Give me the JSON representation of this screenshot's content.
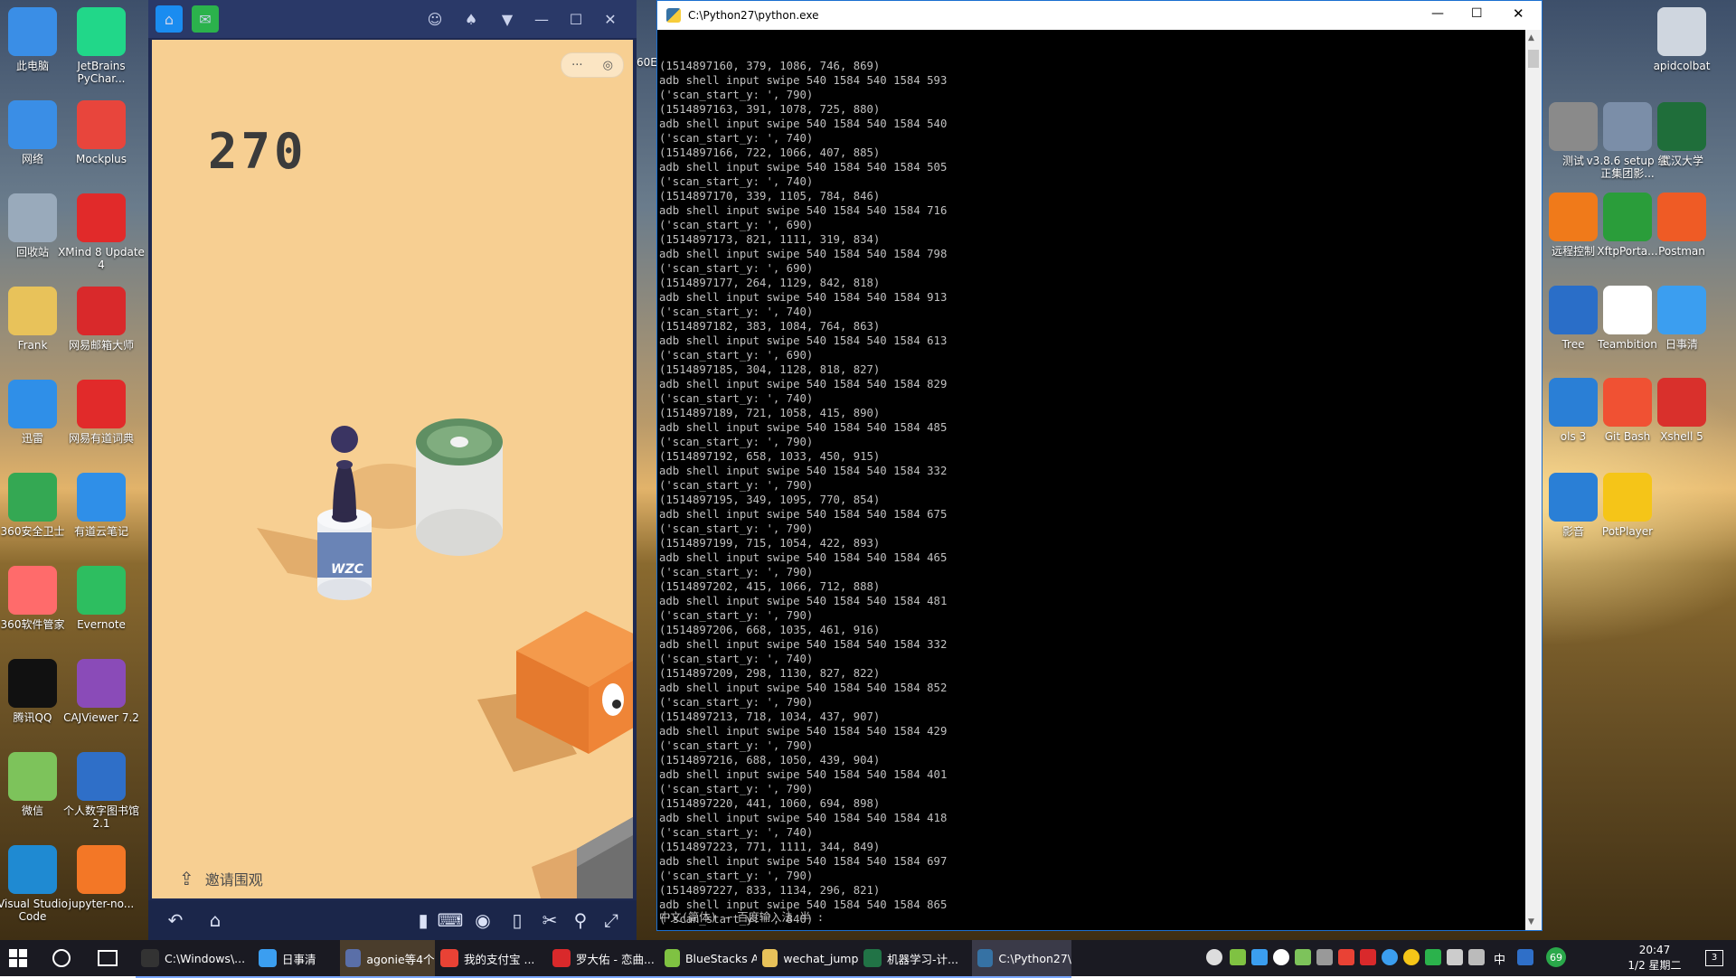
{
  "desktop": {
    "left_icons": [
      {
        "label": "此电脑",
        "icon": "computer-icon",
        "color": "#3a8ee6"
      },
      {
        "label": "JetBrains PyChar...",
        "icon": "pycharm-icon",
        "color": "#21d789"
      },
      {
        "label": "网络",
        "icon": "network-icon",
        "color": "#3a8ee6"
      },
      {
        "label": "Mockplus",
        "icon": "mockplus-icon",
        "color": "#e8453c"
      },
      {
        "label": "回收站",
        "icon": "recycle-bin-icon",
        "color": "#9ab"
      },
      {
        "label": "XMind 8 Update 4",
        "icon": "xmind-icon",
        "color": "#e12a2a"
      },
      {
        "label": "Frank",
        "icon": "user-folder-icon",
        "color": "#e8c25a"
      },
      {
        "label": "网易邮箱大师",
        "icon": "netease-mail-icon",
        "color": "#d9292b"
      },
      {
        "label": "迅雷",
        "icon": "thunder-icon",
        "color": "#2f8fe8"
      },
      {
        "label": "网易有道词典",
        "icon": "youdao-dict-icon",
        "color": "#e12a2a"
      },
      {
        "label": "360安全卫士",
        "icon": "360-security-icon",
        "color": "#34a853"
      },
      {
        "label": "有道云笔记",
        "icon": "youdao-note-icon",
        "color": "#2f8fe8"
      },
      {
        "label": "360软件管家",
        "icon": "360-software-icon",
        "color": "#ff6b6b"
      },
      {
        "label": "Evernote",
        "icon": "evernote-icon",
        "color": "#2dbe60"
      },
      {
        "label": "腾讯QQ",
        "icon": "qq-icon",
        "color": "#111"
      },
      {
        "label": "CAJViewer 7.2",
        "icon": "cajviewer-icon",
        "color": "#8a4bb8"
      },
      {
        "label": "微信",
        "icon": "wechat-icon",
        "color": "#7dc35b"
      },
      {
        "label": "个人数字图书馆2.1",
        "icon": "digital-library-icon",
        "color": "#2f6fc8"
      },
      {
        "label": "Visual Studio Code",
        "icon": "vscode-icon",
        "color": "#1f8ad2"
      },
      {
        "label": "jupyter-no...",
        "icon": "jupyter-icon",
        "color": "#f37726"
      }
    ],
    "right_icons": [
      {
        "label": "apidcolbat",
        "icon": "gear-file-icon",
        "color": "#cfd6df"
      },
      {
        "label": "测试",
        "icon": "printer-icon",
        "color": "#8a8a8a"
      },
      {
        "label": "v3.8.6 setup 纯正集团影...",
        "icon": "setup-icon",
        "color": "#7b8ea8"
      },
      {
        "label": "武汉大学",
        "icon": "whu-logo-icon",
        "color": "#1f6e3a"
      },
      {
        "label": "远程控制",
        "icon": "remote-icon",
        "color": "#f07a1a"
      },
      {
        "label": "XftpPorta...",
        "icon": "xftp-icon",
        "color": "#2a9d3a"
      },
      {
        "label": "Postman",
        "icon": "postman-icon",
        "color": "#ef5b25"
      },
      {
        "label": "Tree",
        "icon": "sourcetree-icon",
        "color": "#2a6ec8"
      },
      {
        "label": "Teambition",
        "icon": "teambition-icon",
        "color": "#fff"
      },
      {
        "label": "日事清",
        "icon": "rishiqing-icon",
        "color": "#3b9ef0"
      },
      {
        "label": "ols 3",
        "icon": "tools-icon",
        "color": "#2a7fd6"
      },
      {
        "label": "Git Bash",
        "icon": "git-bash-icon",
        "color": "#f05133"
      },
      {
        "label": "Xshell 5",
        "icon": "xshell-icon",
        "color": "#d9302c"
      },
      {
        "label": "影音",
        "icon": "media-icon",
        "color": "#2a7fd6"
      },
      {
        "label": "PotPlayer",
        "icon": "potplayer-icon",
        "color": "#f5c518"
      }
    ],
    "partial_labels": [
      "60E",
      "60E"
    ]
  },
  "bluestacks": {
    "title_tabs": [
      {
        "icon": "home-icon"
      },
      {
        "icon": "wechat-icon"
      }
    ],
    "title_controls": [
      "account-icon",
      "shirt-icon",
      "menu-down-icon",
      "minimize-icon",
      "maximize-icon",
      "close-icon"
    ],
    "game": {
      "score": "270",
      "piece_label": "WZC",
      "invite_text": "邀请围观",
      "capsule_more": "···",
      "capsule_target": "◎"
    },
    "bottom_icons": [
      "back-icon",
      "home-icon",
      "portrait-icon",
      "keyboard-icon",
      "eye-icon",
      "phone-icon",
      "scissors-icon",
      "location-icon",
      "fullscreen-icon"
    ]
  },
  "console": {
    "title": "C:\\Python27\\python.exe",
    "lines": [
      "(1514897160, 379, 1086, 746, 869)",
      "adb shell input swipe 540 1584 540 1584 593",
      "('scan_start_y: ', 790)",
      "(1514897163, 391, 1078, 725, 880)",
      "adb shell input swipe 540 1584 540 1584 540",
      "('scan_start_y: ', 740)",
      "(1514897166, 722, 1066, 407, 885)",
      "adb shell input swipe 540 1584 540 1584 505",
      "('scan_start_y: ', 740)",
      "(1514897170, 339, 1105, 784, 846)",
      "adb shell input swipe 540 1584 540 1584 716",
      "('scan_start_y: ', 690)",
      "(1514897173, 821, 1111, 319, 834)",
      "adb shell input swipe 540 1584 540 1584 798",
      "('scan_start_y: ', 690)",
      "(1514897177, 264, 1129, 842, 818)",
      "adb shell input swipe 540 1584 540 1584 913",
      "('scan_start_y: ', 740)",
      "(1514897182, 383, 1084, 764, 863)",
      "adb shell input swipe 540 1584 540 1584 613",
      "('scan_start_y: ', 690)",
      "(1514897185, 304, 1128, 818, 827)",
      "adb shell input swipe 540 1584 540 1584 829",
      "('scan_start_y: ', 740)",
      "(1514897189, 721, 1058, 415, 890)",
      "adb shell input swipe 540 1584 540 1584 485",
      "('scan_start_y: ', 790)",
      "(1514897192, 658, 1033, 450, 915)",
      "adb shell input swipe 540 1584 540 1584 332",
      "('scan_start_y: ', 790)",
      "(1514897195, 349, 1095, 770, 854)",
      "adb shell input swipe 540 1584 540 1584 675",
      "('scan_start_y: ', 790)",
      "(1514897199, 715, 1054, 422, 893)",
      "adb shell input swipe 540 1584 540 1584 465",
      "('scan_start_y: ', 790)",
      "(1514897202, 415, 1066, 712, 888)",
      "adb shell input swipe 540 1584 540 1584 481",
      "('scan_start_y: ', 790)",
      "(1514897206, 668, 1035, 461, 916)",
      "adb shell input swipe 540 1584 540 1584 332",
      "('scan_start_y: ', 740)",
      "(1514897209, 298, 1130, 827, 822)",
      "adb shell input swipe 540 1584 540 1584 852",
      "('scan_start_y: ', 790)",
      "(1514897213, 718, 1034, 437, 907)",
      "adb shell input swipe 540 1584 540 1584 429",
      "('scan_start_y: ', 790)",
      "(1514897216, 688, 1050, 439, 904)",
      "adb shell input swipe 540 1584 540 1584 401",
      "('scan_start_y: ', 790)",
      "(1514897220, 441, 1060, 694, 898)",
      "adb shell input swipe 540 1584 540 1584 418",
      "('scan_start_y: ', 740)",
      "(1514897223, 771, 1111, 344, 849)",
      "adb shell input swipe 540 1584 540 1584 697",
      "('scan_start_y: ', 790)",
      "(1514897227, 833, 1134, 296, 821)",
      "adb shell input swipe 540 1584 540 1584 865",
      "('scan_start_y: ', 840)"
    ],
    "ime_status": "中文(简体) - 百度输入法 半 :"
  },
  "taskbar": {
    "tasks": [
      {
        "label": "C:\\Windows\\...",
        "icon": "cmd-icon",
        "color": "#333"
      },
      {
        "label": "日事清",
        "icon": "rishiqing-icon",
        "color": "#3b9ef0"
      },
      {
        "label": "agonie等4个...",
        "icon": "chat-icon",
        "color": "#5a6fa8"
      },
      {
        "label": "我的支付宝 ...",
        "icon": "chrome-icon",
        "color": "#e94235"
      },
      {
        "label": "罗大佑 - 恋曲...",
        "icon": "netease-music-icon",
        "color": "#d9292b"
      },
      {
        "label": "BlueStacks A...",
        "icon": "bluestacks-icon",
        "color": "#7fc242"
      },
      {
        "label": "wechat_jump...",
        "icon": "folder-icon",
        "color": "#e8c25a"
      },
      {
        "label": "机器学习-计...",
        "icon": "excel-icon",
        "color": "#217346"
      },
      {
        "label": "C:\\Python27\\...",
        "icon": "python-icon",
        "color": "#3672a4"
      }
    ],
    "clock_time": "20:47",
    "clock_date": "1/2 星期二",
    "ime_label": "中",
    "notification_count": "3",
    "badge_69": "69"
  }
}
